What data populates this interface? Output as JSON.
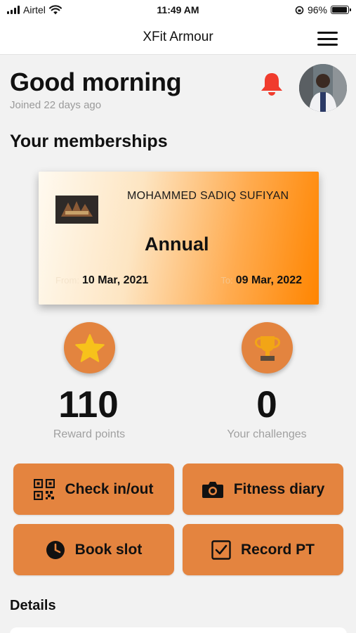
{
  "status_bar": {
    "carrier": "Airtel",
    "time": "11:49 AM",
    "battery": "96%",
    "battery_level": 0.96
  },
  "nav": {
    "title": "XFit Armour",
    "menu_icon": "hamburger-menu-icon"
  },
  "greeting": {
    "title": "Good morning",
    "joined": "Joined 22 days ago",
    "bell_icon": "bell-icon",
    "bell_color": "#f03c2d"
  },
  "memberships": {
    "title": "Your memberships",
    "card": {
      "name": "MOHAMMED SADIQ SUFIYAN",
      "plan": "Annual",
      "from_label": "From:",
      "from_date": "10 Mar, 2021",
      "to_label": "To:",
      "to_date": "09 Mar, 2022"
    }
  },
  "stats": {
    "rewards": {
      "value": "110",
      "label": "Reward points",
      "icon": "star-icon"
    },
    "challenges": {
      "value": "0",
      "label": "Your challenges",
      "icon": "trophy-icon"
    }
  },
  "actions": [
    {
      "label": "Check in/out",
      "icon": "qr-code-icon"
    },
    {
      "label": "Fitness diary",
      "icon": "camera-icon"
    },
    {
      "label": "Book slot",
      "icon": "clock-icon"
    },
    {
      "label": "Record PT",
      "icon": "checkbox-icon"
    }
  ],
  "details": {
    "title": "Details"
  },
  "colors": {
    "accent": "#e4843f",
    "card_gradient_end": "#ff8500",
    "star": "#f7c21b",
    "trophy": "#f2a516"
  }
}
